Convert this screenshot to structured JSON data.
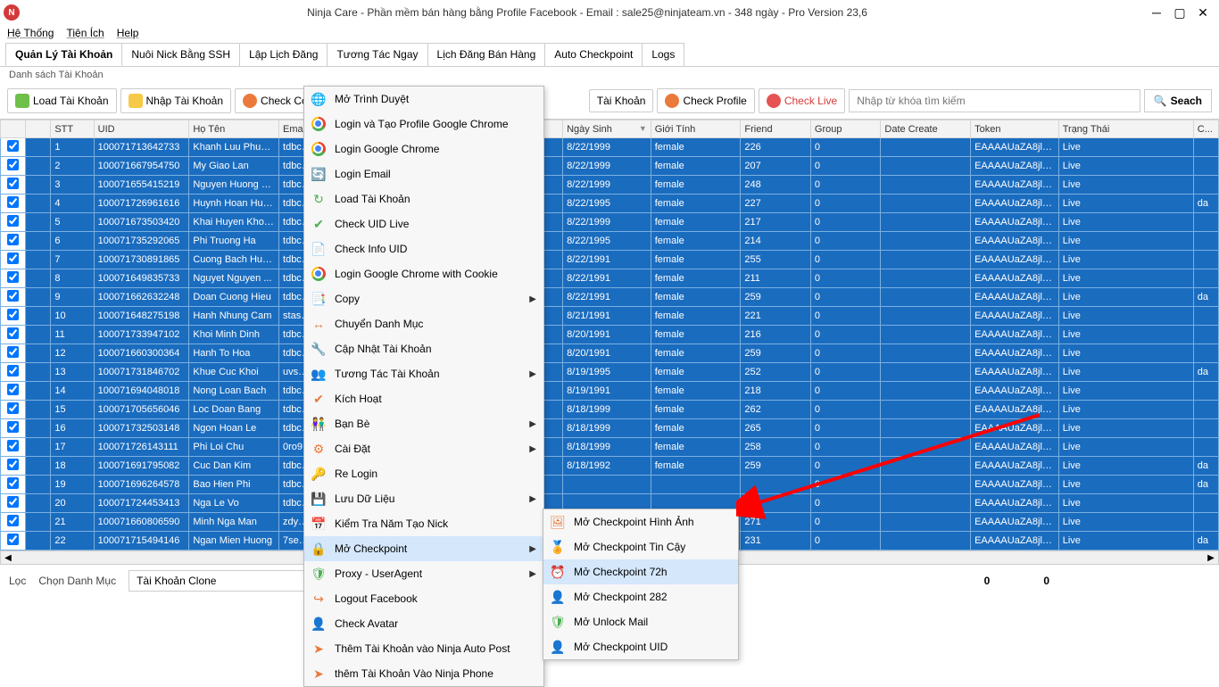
{
  "title": "Ninja Care - Phần mềm bán hàng bằng Profile Facebook - Email : sale25@ninjateam.vn - 348 ngày - Pro Version 23,6",
  "menus": [
    "Hệ Thống",
    "Tiện Ích",
    "Help"
  ],
  "tabs": [
    "Quản Lý Tài Khoản",
    "Nuôi Nick Bằng SSH",
    "Lập Lịch Đăng",
    "Tương Tác Ngay",
    "Lịch Đăng Bán Hàng",
    "Auto Checkpoint",
    "Logs"
  ],
  "sectionLabel": "Danh sách Tài Khoản",
  "toolbar": {
    "load": "Load Tài Khoản",
    "import": "Nhập Tài Khoản",
    "check_cookies": "Check Cookies",
    "account_partial": "Tài Khoản",
    "check_profile": "Check Profile",
    "check_live": "Check Live",
    "search_placeholder": "Nhập từ khóa tìm kiếm",
    "search_btn": "Seach"
  },
  "headers": [
    "",
    "STT",
    "UID",
    "Họ Tên",
    "Email",
    "Ngày Sinh",
    "Giới Tính",
    "Friend",
    "Group",
    "Date Create",
    "Token",
    "Trạng Thái",
    "C..."
  ],
  "rows": [
    {
      "stt": "1",
      "uid": "100071713642733",
      "name": "Khanh Luu Phuong",
      "email": "tdbccb...",
      "dob": "8/22/1999",
      "sex": "female",
      "friend": "226",
      "group": "0",
      "token": "EAAAAUaZA8jlA...",
      "status": "Live",
      "ext": ""
    },
    {
      "stt": "2",
      "uid": "100071667954750",
      "name": "My Giao Lan",
      "email": "tdbcfe...",
      "dob": "8/22/1999",
      "sex": "female",
      "friend": "207",
      "group": "0",
      "token": "EAAAAUaZA8jlA...",
      "status": "Live",
      "ext": ""
    },
    {
      "stt": "3",
      "uid": "100071655415219",
      "name": "Nguyen Huong H...",
      "email": "tdbcix...",
      "dob": "8/22/1999",
      "sex": "female",
      "friend": "248",
      "group": "0",
      "token": "EAAAAUaZA8jlA...",
      "status": "Live",
      "ext": ""
    },
    {
      "stt": "4",
      "uid": "100071726961616",
      "name": "Huynh Hoan Huo...",
      "email": "tdbcn...",
      "dob": "8/22/1995",
      "sex": "female",
      "friend": "227",
      "group": "0",
      "token": "EAAAAUaZA8jlA...",
      "status": "Live",
      "ext": "da"
    },
    {
      "stt": "5",
      "uid": "100071673503420",
      "name": "Khai Huyen Khong",
      "email": "tdbcbts...",
      "dob": "8/22/1999",
      "sex": "female",
      "friend": "217",
      "group": "0",
      "token": "EAAAAUaZA8jlA...",
      "status": "Live",
      "ext": ""
    },
    {
      "stt": "6",
      "uid": "100071735292065",
      "name": "Phi Truong Ha",
      "email": "tdbcos...",
      "dob": "8/22/1995",
      "sex": "female",
      "friend": "214",
      "group": "0",
      "token": "EAAAAUaZA8jlA...",
      "status": "Live",
      "ext": ""
    },
    {
      "stt": "7",
      "uid": "100071730891865",
      "name": "Cuong Bach Huo...",
      "email": "tdbcv0...",
      "dob": "8/22/1991",
      "sex": "female",
      "friend": "255",
      "group": "0",
      "token": "EAAAAUaZA8jlA...",
      "status": "Live",
      "ext": ""
    },
    {
      "stt": "8",
      "uid": "100071649835733",
      "name": "Nguyet Nguyen ...",
      "email": "tdbcc...",
      "dob": "8/22/1991",
      "sex": "female",
      "friend": "211",
      "group": "0",
      "token": "EAAAAUaZA8jlA...",
      "status": "Live",
      "ext": ""
    },
    {
      "stt": "9",
      "uid": "100071662632248",
      "name": "Doan Cuong Hieu",
      "email": "tdbciv...",
      "dob": "8/22/1991",
      "sex": "female",
      "friend": "259",
      "group": "0",
      "token": "EAAAAUaZA8jlA...",
      "status": "Live",
      "ext": "da"
    },
    {
      "stt": "10",
      "uid": "100071648275198",
      "name": "Hanh Nhung Cam",
      "email": "stasko...",
      "dob": "8/21/1991",
      "sex": "female",
      "friend": "221",
      "group": "0",
      "token": "EAAAAUaZA8jlA...",
      "status": "Live",
      "ext": ""
    },
    {
      "stt": "11",
      "uid": "100071733947102",
      "name": "Khoi Minh Dinh",
      "email": "tdbcc...",
      "dob": "8/20/1991",
      "sex": "female",
      "friend": "216",
      "group": "0",
      "token": "EAAAAUaZA8jlA...",
      "status": "Live",
      "ext": ""
    },
    {
      "stt": "12",
      "uid": "100071660300364",
      "name": "Hanh To Hoa",
      "email": "tdbcbj9...",
      "dob": "8/20/1991",
      "sex": "female",
      "friend": "259",
      "group": "0",
      "token": "EAAAAUaZA8jlA...",
      "status": "Live",
      "ext": ""
    },
    {
      "stt": "13",
      "uid": "100071731846702",
      "name": "Khue Cuc Khoi",
      "email": "uvs7ryl...",
      "dob": "8/19/1995",
      "sex": "female",
      "friend": "252",
      "group": "0",
      "token": "EAAAAUaZA8jlA...",
      "status": "Live",
      "ext": "da"
    },
    {
      "stt": "14",
      "uid": "100071694048018",
      "name": "Nong Loan Bach",
      "email": "tdbc5k...",
      "dob": "8/19/1991",
      "sex": "female",
      "friend": "218",
      "group": "0",
      "token": "EAAAAUaZA8jlA...",
      "status": "Live",
      "ext": ""
    },
    {
      "stt": "15",
      "uid": "100071705656046",
      "name": "Loc Doan Bang",
      "email": "tdbcrz...",
      "dob": "8/18/1999",
      "sex": "female",
      "friend": "262",
      "group": "0",
      "token": "EAAAAUaZA8jlA...",
      "status": "Live",
      "ext": ""
    },
    {
      "stt": "16",
      "uid": "100071732503148",
      "name": "Ngon Hoan Le",
      "email": "tdbcet...",
      "dob": "8/18/1999",
      "sex": "female",
      "friend": "265",
      "group": "0",
      "token": "EAAAAUaZA8jlA...",
      "status": "Live",
      "ext": ""
    },
    {
      "stt": "17",
      "uid": "100071726143111",
      "name": "Phi Loi Chu",
      "email": "0ro9zh...",
      "dob": "8/18/1999",
      "sex": "female",
      "friend": "258",
      "group": "0",
      "token": "EAAAAUaZA8jlA...",
      "status": "Live",
      "ext": ""
    },
    {
      "stt": "18",
      "uid": "100071691795082",
      "name": "Cuc Dan Kim",
      "email": "tdbcct...",
      "dob": "8/18/1992",
      "sex": "female",
      "friend": "259",
      "group": "0",
      "token": "EAAAAUaZA8jlA...",
      "status": "Live",
      "ext": "da"
    },
    {
      "stt": "19",
      "uid": "100071696264578",
      "name": "Bao Hien Phi",
      "email": "tdbclk...",
      "dob": "",
      "sex": "",
      "friend": "",
      "group": "0",
      "token": "EAAAAUaZA8jlA...",
      "status": "Live",
      "ext": "da"
    },
    {
      "stt": "20",
      "uid": "100071724453413",
      "name": "Nga Le Vo",
      "email": "tdbcwt...",
      "dob": "",
      "sex": "",
      "friend": "273",
      "group": "0",
      "token": "EAAAAUaZA8jlA...",
      "status": "Live",
      "ext": ""
    },
    {
      "stt": "21",
      "uid": "100071660806590",
      "name": "Minh Nga Man",
      "email": "zdypf7...",
      "dob": "",
      "sex": "",
      "friend": "271",
      "group": "0",
      "token": "EAAAAUaZA8jlA...",
      "status": "Live",
      "ext": ""
    },
    {
      "stt": "22",
      "uid": "100071715494146",
      "name": "Ngan Mien Huong",
      "email": "7seveg...",
      "dob": "",
      "sex": "",
      "friend": "231",
      "group": "0",
      "token": "EAAAAUaZA8jlA...",
      "status": "Live",
      "ext": "da"
    }
  ],
  "footer": {
    "filter_label": "Lọc",
    "category_label": "Chọn Danh Mục",
    "category_value": "Tài Khoản Clone",
    "count1": "0",
    "count2": "0"
  },
  "context_menu": [
    {
      "label": "Mở Trình Duyệt",
      "icon": "globe",
      "col": "orange"
    },
    {
      "label": "Login và Tạo Profile Google Chrome",
      "icon": "chrome"
    },
    {
      "label": "Login Google Chrome",
      "icon": "chrome"
    },
    {
      "label": "Login Email",
      "icon": "refresh",
      "col": "grey"
    },
    {
      "label": "Load Tài Khoản",
      "icon": "reload",
      "col": "green"
    },
    {
      "label": "Check UID Live",
      "icon": "check",
      "col": "green"
    },
    {
      "label": "Check Info UID",
      "icon": "doc",
      "col": "orange"
    },
    {
      "label": "Login Google Chrome with Cookie",
      "icon": "chrome"
    },
    {
      "label": "Copy",
      "icon": "copy",
      "col": "orange",
      "sub": true
    },
    {
      "label": "Chuyển Danh Mục",
      "icon": "transfer",
      "col": "orange"
    },
    {
      "label": "Cập Nhật Tài Khoản",
      "icon": "update",
      "col": "orange"
    },
    {
      "label": "Tương Tác Tài Khoản",
      "icon": "people",
      "col": "orange",
      "sub": true
    },
    {
      "label": "Kích Hoạt",
      "icon": "check",
      "col": "orange"
    },
    {
      "label": "Bạn Bè",
      "icon": "friends",
      "col": "orange",
      "sub": true
    },
    {
      "label": "Cài Đặt",
      "icon": "gear",
      "col": "orange",
      "sub": true
    },
    {
      "label": "Re Login",
      "icon": "key",
      "col": "orange"
    },
    {
      "label": "Lưu Dữ Liệu",
      "icon": "save",
      "col": "orange",
      "sub": true
    },
    {
      "label": "Kiểm Tra Năm Tạo Nick",
      "icon": "calendar",
      "col": "orange"
    },
    {
      "label": "Mở Checkpoint",
      "icon": "lock",
      "col": "orange",
      "sub": true,
      "highlight": true
    },
    {
      "label": "Proxy - UserAgent",
      "icon": "shield",
      "col": "green",
      "sub": true
    },
    {
      "label": "Logout Facebook",
      "icon": "logout",
      "col": "orange"
    },
    {
      "label": "Check Avatar",
      "icon": "avatar",
      "col": "orange"
    },
    {
      "label": "Thêm Tài Khoản vào Ninja Auto Post",
      "icon": "send",
      "col": "orange"
    },
    {
      "label": "thêm Tài Khoản Vào Ninja Phone",
      "icon": "send",
      "col": "orange"
    }
  ],
  "sub_menu": [
    {
      "label": "Mở Checkpoint Hình Ảnh",
      "icon": "image",
      "col": "orange"
    },
    {
      "label": "Mở Checkpoint Tin Cậy",
      "icon": "badge",
      "col": "orange"
    },
    {
      "label": "Mở Checkpoint 72h",
      "icon": "clock",
      "col": "orange",
      "highlight": true
    },
    {
      "label": "Mở Checkpoint 282",
      "icon": "user",
      "col": "orange"
    },
    {
      "label": "Mở Unlock Mail",
      "icon": "shield",
      "col": "green"
    },
    {
      "label": "Mở Checkpoint UID",
      "icon": "user",
      "col": "orange"
    }
  ]
}
